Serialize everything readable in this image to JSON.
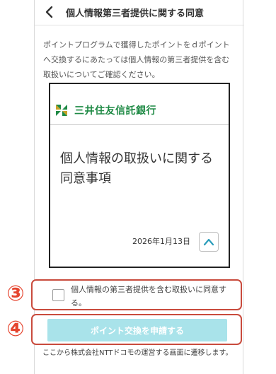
{
  "header": {
    "title": "個人情報第三者提供に関する同意"
  },
  "intro": "ポイントプログラムで獲得したポイントをｄポイントへ交換するにあたっては個人情報の第三者提供を含む取扱いについてご確認ください。",
  "document": {
    "bank_name": "三井住友信託銀行",
    "title": "個人情報の取扱いに関する同意事項",
    "date": "2026年1月13日"
  },
  "steps": {
    "three": "③",
    "four": "④"
  },
  "consent": {
    "label": "個人情報の第三者提供を含む取扱いに同意する。",
    "checked": false
  },
  "submit": {
    "label": "ポイント交換を申請する"
  },
  "footer": {
    "note": "ここから株式会社NTTドコモの運営する画面に遷移します。"
  },
  "colors": {
    "accent_red": "#c94b3d",
    "button_disabled": "#a9e3ea",
    "bank_green": "#1f8a45"
  }
}
